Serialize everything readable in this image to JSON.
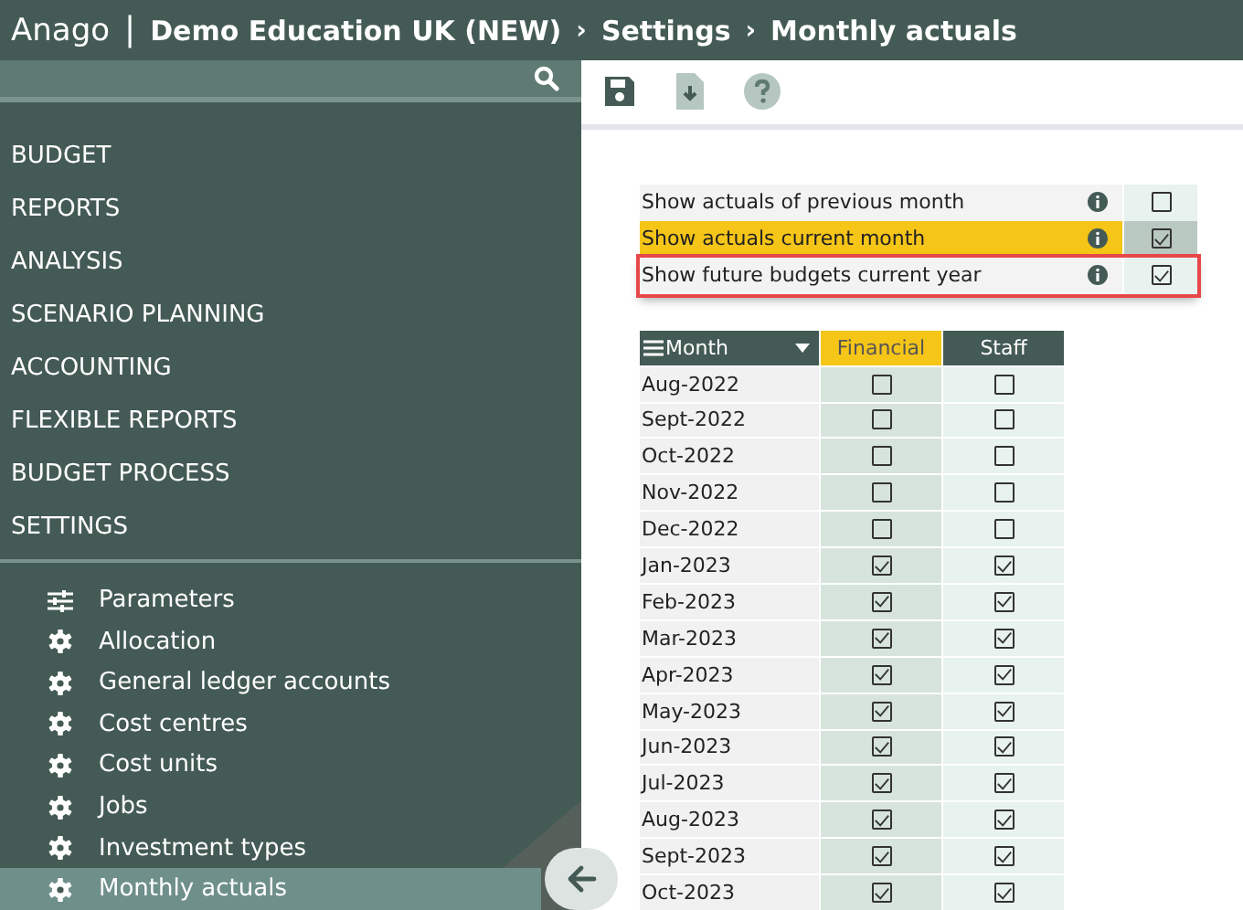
{
  "header": {
    "logo": "Anago",
    "separator": "|",
    "breadcrumb": [
      "Demo Education UK (NEW)",
      "Settings",
      "Monthly actuals"
    ],
    "breadcrumb_separator": "›"
  },
  "sidebar": {
    "menu": [
      {
        "label": "BUDGET"
      },
      {
        "label": "REPORTS"
      },
      {
        "label": "ANALYSIS"
      },
      {
        "label": "SCENARIO PLANNING"
      },
      {
        "label": "ACCOUNTING"
      },
      {
        "label": "FLEXIBLE REPORTS"
      },
      {
        "label": "BUDGET PROCESS"
      },
      {
        "label": "SETTINGS"
      }
    ],
    "submenu": [
      {
        "label": "Parameters",
        "kind": "sliders",
        "selected": false
      },
      {
        "label": "Allocation",
        "kind": "gear",
        "selected": false
      },
      {
        "label": "General ledger accounts",
        "kind": "gear",
        "selected": false
      },
      {
        "label": "Cost centres",
        "kind": "gear",
        "selected": false
      },
      {
        "label": "Cost units",
        "kind": "gear",
        "selected": false
      },
      {
        "label": "Jobs",
        "kind": "gear",
        "selected": false
      },
      {
        "label": "Investment types",
        "kind": "gear",
        "selected": false
      },
      {
        "label": "Monthly actuals",
        "kind": "gear",
        "selected": true
      }
    ]
  },
  "options": [
    {
      "label": "Show actuals of previous month",
      "checked": false,
      "highlighted": false,
      "outlined": false
    },
    {
      "label": "Show actuals current month",
      "checked": true,
      "highlighted": true,
      "outlined": false
    },
    {
      "label": "Show future budgets current year",
      "checked": true,
      "highlighted": false,
      "outlined": true
    }
  ],
  "table": {
    "columns": [
      {
        "label": "Month",
        "highlighted": false
      },
      {
        "label": "Financial",
        "highlighted": true
      },
      {
        "label": "Staff",
        "highlighted": false
      }
    ],
    "rows": [
      {
        "month": "Aug-2022",
        "financial": false,
        "staff": false
      },
      {
        "month": "Sept-2022",
        "financial": false,
        "staff": false
      },
      {
        "month": "Oct-2022",
        "financial": false,
        "staff": false
      },
      {
        "month": "Nov-2022",
        "financial": false,
        "staff": false
      },
      {
        "month": "Dec-2022",
        "financial": false,
        "staff": false
      },
      {
        "month": "Jan-2023",
        "financial": true,
        "staff": true
      },
      {
        "month": "Feb-2023",
        "financial": true,
        "staff": true
      },
      {
        "month": "Mar-2023",
        "financial": true,
        "staff": true
      },
      {
        "month": "Apr-2023",
        "financial": true,
        "staff": true
      },
      {
        "month": "May-2023",
        "financial": true,
        "staff": true
      },
      {
        "month": "Jun-2023",
        "financial": true,
        "staff": true
      },
      {
        "month": "Jul-2023",
        "financial": true,
        "staff": true
      },
      {
        "month": "Aug-2023",
        "financial": true,
        "staff": true
      },
      {
        "month": "Sept-2023",
        "financial": true,
        "staff": true
      },
      {
        "month": "Oct-2023",
        "financial": true,
        "staff": true
      }
    ]
  }
}
